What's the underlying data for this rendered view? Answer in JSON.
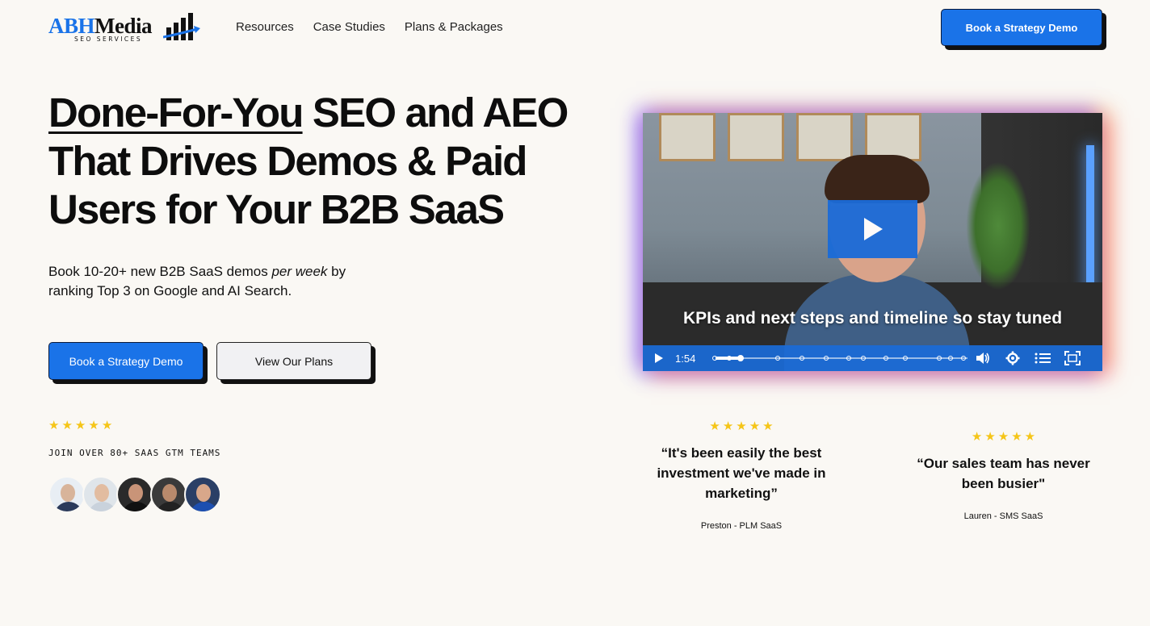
{
  "nav": {
    "logo_brand": "ABH",
    "logo_media": "Media",
    "logo_tagline": "SEO SERVICES",
    "links": [
      "Resources",
      "Case Studies",
      "Plans & Packages"
    ],
    "cta": "Book a Strategy Demo"
  },
  "hero": {
    "title_underlined": "Done-For-You",
    "title_rest": " SEO and AEO That Drives Demos & Paid Users for Your B2B SaaS",
    "sub_part1": "Book 10-20+ new B2B SaaS demos ",
    "sub_em": "per week",
    "sub_part2": " by ranking Top 3 on Google and AI Search.",
    "primary_button": "Book a Strategy Demo",
    "secondary_button": "View Our Plans",
    "rating_stars": 5,
    "join_text": "JOIN OVER 80+ SAAS GTM TEAMS"
  },
  "video": {
    "caption": "KPIs and next steps and timeline so stay tuned",
    "time": "1:54",
    "progress": 0.1,
    "play_icon": "play-icon",
    "controls": [
      "volume-icon",
      "settings-icon",
      "chapters-icon",
      "fullscreen-icon"
    ]
  },
  "testimonials": [
    {
      "stars": 5,
      "quote": "“It's been easily the best investment we've made in marketing”",
      "author": "Preston - PLM SaaS"
    },
    {
      "stars": 5,
      "quote": "“Our sales team has never been busier\"",
      "author": "Lauren - SMS SaaS"
    }
  ],
  "colors": {
    "accent": "#1a73e8",
    "background": "#faf8f4",
    "star": "#f5c518"
  }
}
